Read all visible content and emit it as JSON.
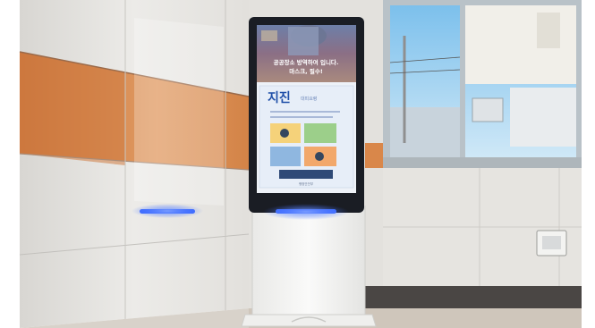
{
  "photo": {
    "subject": "digital signage kiosk",
    "colors": {
      "wall_tile": "#e6e4e0",
      "orange_band": "#d9874a",
      "window_sky": "#8ec9ee",
      "window_frame": "#b9c2c8",
      "kiosk_body": "#f4f4f2",
      "screen_bezel": "#1a1d24",
      "led_glow": "#3d6bff",
      "floor_skirting": "#4a4644"
    }
  },
  "screen": {
    "video_caption_line1": "공공장소 방역하여 입니다.",
    "video_caption_line2": "마스크, 필수!",
    "poster_title": "지진",
    "poster_subtitle": "대피요령",
    "poster_footer": "행정안전부"
  }
}
